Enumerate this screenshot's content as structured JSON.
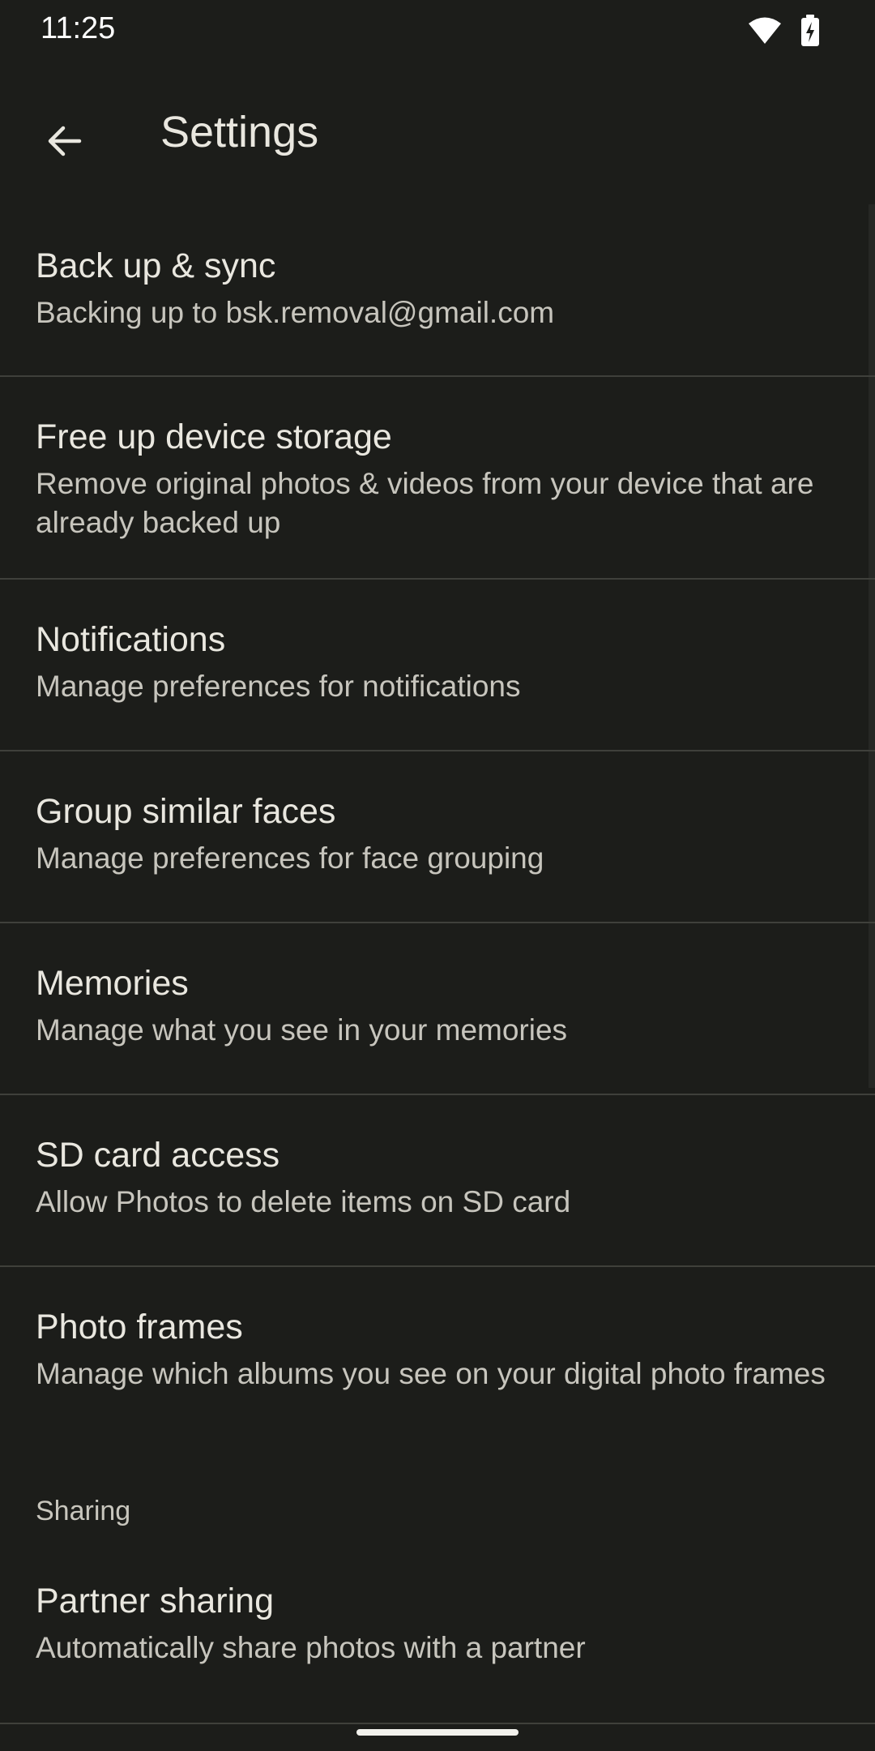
{
  "status_bar": {
    "time": "11:25",
    "icons": [
      "wifi-icon",
      "battery-charging-icon"
    ]
  },
  "app_bar": {
    "back_icon": "arrow-back-icon",
    "title": "Settings"
  },
  "items": [
    {
      "title": "Back up & sync",
      "subtitle": "Backing up to bsk.removal@gmail.com"
    },
    {
      "title": "Free up device storage",
      "subtitle": "Remove original photos & videos from your device that are already backed up"
    },
    {
      "title": "Notifications",
      "subtitle": "Manage preferences for notifications"
    },
    {
      "title": "Group similar faces",
      "subtitle": "Manage preferences for face grouping"
    },
    {
      "title": "Memories",
      "subtitle": "Manage what you see in your memories"
    },
    {
      "title": "SD card access",
      "subtitle": "Allow Photos to delete items on SD card"
    },
    {
      "title": "Photo frames",
      "subtitle": "Manage which albums you see on your digital photo frames"
    }
  ],
  "sharing": {
    "header": "Sharing",
    "items": [
      {
        "title": "Partner sharing",
        "subtitle": "Automatically share photos with a partner"
      }
    ]
  },
  "colors": {
    "background": "#1c1d1a",
    "title_text": "#e9e7df",
    "subtitle_text": "#c7c5bd",
    "divider": "#3f403b"
  }
}
